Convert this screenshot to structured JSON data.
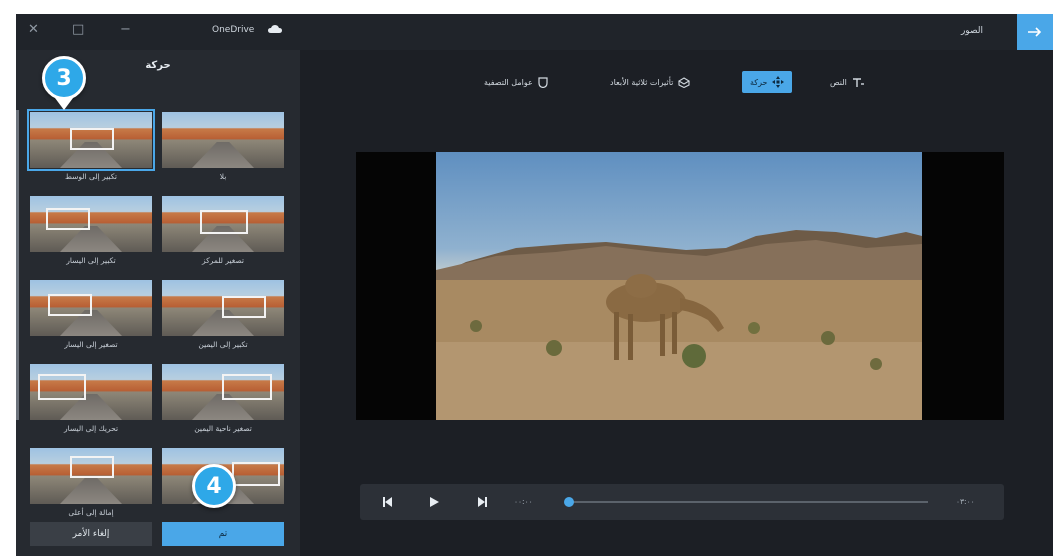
{
  "window": {
    "app_name": "OneDrive",
    "back_label": "الصور"
  },
  "sidebar": {
    "title": "حركة",
    "thumbnails": [
      {
        "label": "تكبير إلى الوسط",
        "selected": true
      },
      {
        "label": "بلا",
        "selected": false
      },
      {
        "label": "تكبير إلى اليسار",
        "selected": false
      },
      {
        "label": "تصغير للمركز",
        "selected": false
      },
      {
        "label": "تصغير إلى اليسار",
        "selected": false
      },
      {
        "label": "تكبير إلى اليمين",
        "selected": false
      },
      {
        "label": "تحريك إلى اليسار",
        "selected": false
      },
      {
        "label": "تصغير ناحية اليمين",
        "selected": false
      },
      {
        "label": "إمالة إلى أعلى",
        "selected": false
      },
      {
        "label": "",
        "selected": false
      }
    ],
    "done_label": "تم",
    "cancel_label": "إلغاء الأمر"
  },
  "callouts": {
    "step_a": "3",
    "step_b": "4"
  },
  "toolbar": {
    "items": [
      {
        "label": "عوامل التصفية",
        "icon": "filter-icon",
        "active": false
      },
      {
        "label": "تأثيرات ثلاثية الأبعاد",
        "icon": "3d-effects-icon",
        "active": false
      },
      {
        "label": "حركة",
        "icon": "motion-icon",
        "active": true
      },
      {
        "label": "النص",
        "icon": "text-icon",
        "active": false
      }
    ]
  },
  "playback": {
    "current_time": "٠٠:٠٠",
    "end_time": "٠٣:٠٠"
  },
  "colors": {
    "accent": "#4aa7e8",
    "background": "#1c1f25",
    "sidebar": "#262a30"
  }
}
